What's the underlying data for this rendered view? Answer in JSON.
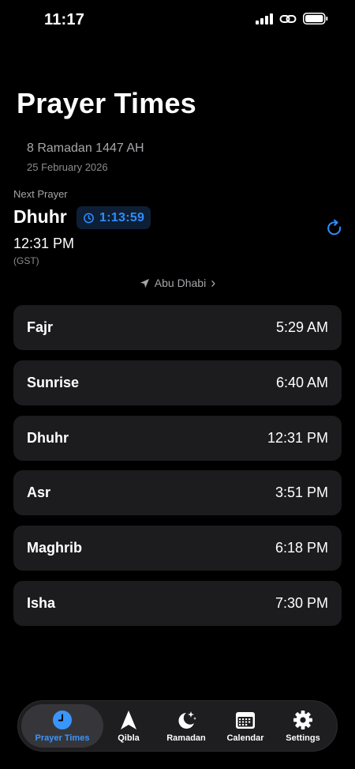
{
  "status_bar": {
    "time": "11:17"
  },
  "header": {
    "title": "Prayer Times",
    "hijri_date": "8 Ramadan 1447 AH",
    "gregorian_date": "25 February 2026"
  },
  "next_prayer": {
    "label": "Next Prayer",
    "name": "Dhuhr",
    "countdown": "1:13:59",
    "time": "12:31 PM",
    "timezone": "(GST)"
  },
  "location": {
    "city": "Abu Dhabi",
    "chevron": "›"
  },
  "prayers": [
    {
      "name": "Fajr",
      "time": "5:29 AM"
    },
    {
      "name": "Sunrise",
      "time": "6:40 AM"
    },
    {
      "name": "Dhuhr",
      "time": "12:31 PM"
    },
    {
      "name": "Asr",
      "time": "3:51 PM"
    },
    {
      "name": "Maghrib",
      "time": "6:18 PM"
    },
    {
      "name": "Isha",
      "time": "7:30 PM"
    }
  ],
  "tab_bar": {
    "tabs": [
      {
        "label": "Prayer Times",
        "icon": "clock-icon",
        "active": true
      },
      {
        "label": "Qibla",
        "icon": "compass-arrow-icon",
        "active": false
      },
      {
        "label": "Ramadan",
        "icon": "crescent-stars-icon",
        "active": false
      },
      {
        "label": "Calendar",
        "icon": "calendar-icon",
        "active": false
      },
      {
        "label": "Settings",
        "icon": "gear-icon",
        "active": false
      }
    ]
  },
  "colors": {
    "accent": "#2f8dff",
    "background": "#000000",
    "card": "#1c1c1e",
    "secondary_text": "#a7a7ab"
  }
}
